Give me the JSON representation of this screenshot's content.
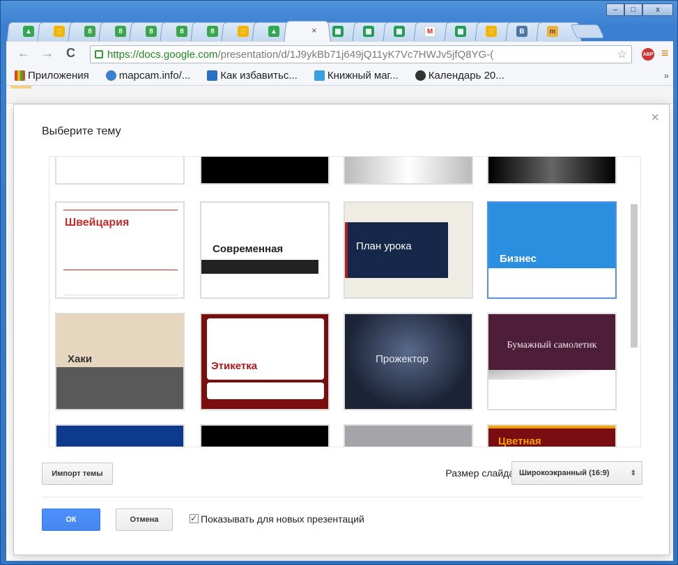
{
  "browser": {
    "url_host": "https://docs.google.com",
    "url_path": "/presentation/d/1J9ykBb71j649jQ11yK7Vc7HWJv5jfQ8YG-(",
    "window_controls": {
      "minimize": "–",
      "maximize": "□",
      "close": "x"
    }
  },
  "bookmarks": [
    {
      "label": "Приложения",
      "icon": "apps-icon",
      "color": "#d9472b"
    },
    {
      "label": "mapcam.info/...",
      "icon": "globe-icon",
      "color": "#3a7fd0"
    },
    {
      "label": "Как избавитьс...",
      "icon": "site-icon",
      "color": "#2a6fc4"
    },
    {
      "label": "Книжный маг...",
      "icon": "book-icon",
      "color": "#3aa0e0"
    },
    {
      "label": "Календарь 20...",
      "icon": "calendar-icon",
      "color": "#333333"
    }
  ],
  "bookmarks_more": "»",
  "dialog": {
    "title": "Выберите тему",
    "close": "×",
    "themes": [
      {
        "name": ""
      },
      {
        "name": ""
      },
      {
        "name": ""
      },
      {
        "name": ""
      },
      {
        "name": "Швейцария"
      },
      {
        "name": "Современная"
      },
      {
        "name": "План урока"
      },
      {
        "name": "Бизнес",
        "selected": true
      },
      {
        "name": "Хаки"
      },
      {
        "name": "Этикетка"
      },
      {
        "name": "Прожектор"
      },
      {
        "name": "Бумажный самолетик"
      },
      {
        "name": ""
      },
      {
        "name": ""
      },
      {
        "name": ""
      },
      {
        "name": "Цветная"
      }
    ],
    "import_button": "Импорт темы",
    "slide_size_label": "Размер слайда:",
    "slide_size_value": "Широкоэкранный (16:9)",
    "ok_button": "ОК",
    "cancel_button": "Отмена",
    "show_for_new_label": "Показывать для новых презентаций",
    "show_for_new_checked": true
  },
  "colors": {
    "accent": "#4d90fe",
    "swiss_red": "#c62b2b",
    "business_blue": "#2b8fe0",
    "label_red": "#7a0d0d"
  }
}
